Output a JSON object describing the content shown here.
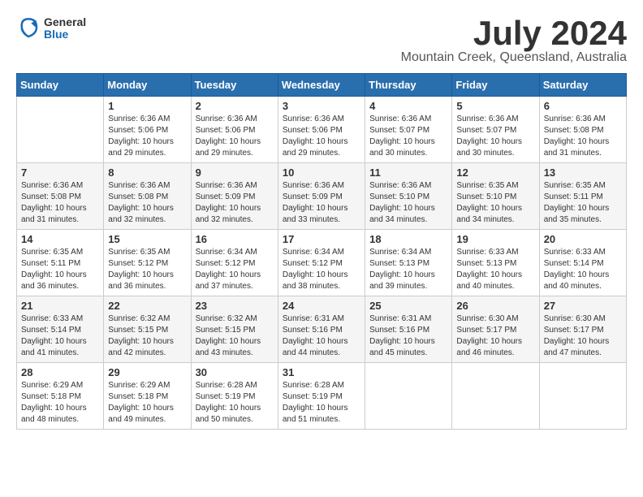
{
  "header": {
    "logo": {
      "general": "General",
      "blue": "Blue"
    },
    "title": "July 2024",
    "subtitle": "Mountain Creek, Queensland, Australia"
  },
  "calendar": {
    "weekdays": [
      "Sunday",
      "Monday",
      "Tuesday",
      "Wednesday",
      "Thursday",
      "Friday",
      "Saturday"
    ],
    "weeks": [
      [
        {
          "day": "",
          "info": ""
        },
        {
          "day": "1",
          "info": "Sunrise: 6:36 AM\nSunset: 5:06 PM\nDaylight: 10 hours\nand 29 minutes."
        },
        {
          "day": "2",
          "info": "Sunrise: 6:36 AM\nSunset: 5:06 PM\nDaylight: 10 hours\nand 29 minutes."
        },
        {
          "day": "3",
          "info": "Sunrise: 6:36 AM\nSunset: 5:06 PM\nDaylight: 10 hours\nand 29 minutes."
        },
        {
          "day": "4",
          "info": "Sunrise: 6:36 AM\nSunset: 5:07 PM\nDaylight: 10 hours\nand 30 minutes."
        },
        {
          "day": "5",
          "info": "Sunrise: 6:36 AM\nSunset: 5:07 PM\nDaylight: 10 hours\nand 30 minutes."
        },
        {
          "day": "6",
          "info": "Sunrise: 6:36 AM\nSunset: 5:08 PM\nDaylight: 10 hours\nand 31 minutes."
        }
      ],
      [
        {
          "day": "7",
          "info": "Sunrise: 6:36 AM\nSunset: 5:08 PM\nDaylight: 10 hours\nand 31 minutes."
        },
        {
          "day": "8",
          "info": "Sunrise: 6:36 AM\nSunset: 5:08 PM\nDaylight: 10 hours\nand 32 minutes."
        },
        {
          "day": "9",
          "info": "Sunrise: 6:36 AM\nSunset: 5:09 PM\nDaylight: 10 hours\nand 32 minutes."
        },
        {
          "day": "10",
          "info": "Sunrise: 6:36 AM\nSunset: 5:09 PM\nDaylight: 10 hours\nand 33 minutes."
        },
        {
          "day": "11",
          "info": "Sunrise: 6:36 AM\nSunset: 5:10 PM\nDaylight: 10 hours\nand 34 minutes."
        },
        {
          "day": "12",
          "info": "Sunrise: 6:35 AM\nSunset: 5:10 PM\nDaylight: 10 hours\nand 34 minutes."
        },
        {
          "day": "13",
          "info": "Sunrise: 6:35 AM\nSunset: 5:11 PM\nDaylight: 10 hours\nand 35 minutes."
        }
      ],
      [
        {
          "day": "14",
          "info": "Sunrise: 6:35 AM\nSunset: 5:11 PM\nDaylight: 10 hours\nand 36 minutes."
        },
        {
          "day": "15",
          "info": "Sunrise: 6:35 AM\nSunset: 5:12 PM\nDaylight: 10 hours\nand 36 minutes."
        },
        {
          "day": "16",
          "info": "Sunrise: 6:34 AM\nSunset: 5:12 PM\nDaylight: 10 hours\nand 37 minutes."
        },
        {
          "day": "17",
          "info": "Sunrise: 6:34 AM\nSunset: 5:12 PM\nDaylight: 10 hours\nand 38 minutes."
        },
        {
          "day": "18",
          "info": "Sunrise: 6:34 AM\nSunset: 5:13 PM\nDaylight: 10 hours\nand 39 minutes."
        },
        {
          "day": "19",
          "info": "Sunrise: 6:33 AM\nSunset: 5:13 PM\nDaylight: 10 hours\nand 40 minutes."
        },
        {
          "day": "20",
          "info": "Sunrise: 6:33 AM\nSunset: 5:14 PM\nDaylight: 10 hours\nand 40 minutes."
        }
      ],
      [
        {
          "day": "21",
          "info": "Sunrise: 6:33 AM\nSunset: 5:14 PM\nDaylight: 10 hours\nand 41 minutes."
        },
        {
          "day": "22",
          "info": "Sunrise: 6:32 AM\nSunset: 5:15 PM\nDaylight: 10 hours\nand 42 minutes."
        },
        {
          "day": "23",
          "info": "Sunrise: 6:32 AM\nSunset: 5:15 PM\nDaylight: 10 hours\nand 43 minutes."
        },
        {
          "day": "24",
          "info": "Sunrise: 6:31 AM\nSunset: 5:16 PM\nDaylight: 10 hours\nand 44 minutes."
        },
        {
          "day": "25",
          "info": "Sunrise: 6:31 AM\nSunset: 5:16 PM\nDaylight: 10 hours\nand 45 minutes."
        },
        {
          "day": "26",
          "info": "Sunrise: 6:30 AM\nSunset: 5:17 PM\nDaylight: 10 hours\nand 46 minutes."
        },
        {
          "day": "27",
          "info": "Sunrise: 6:30 AM\nSunset: 5:17 PM\nDaylight: 10 hours\nand 47 minutes."
        }
      ],
      [
        {
          "day": "28",
          "info": "Sunrise: 6:29 AM\nSunset: 5:18 PM\nDaylight: 10 hours\nand 48 minutes."
        },
        {
          "day": "29",
          "info": "Sunrise: 6:29 AM\nSunset: 5:18 PM\nDaylight: 10 hours\nand 49 minutes."
        },
        {
          "day": "30",
          "info": "Sunrise: 6:28 AM\nSunset: 5:19 PM\nDaylight: 10 hours\nand 50 minutes."
        },
        {
          "day": "31",
          "info": "Sunrise: 6:28 AM\nSunset: 5:19 PM\nDaylight: 10 hours\nand 51 minutes."
        },
        {
          "day": "",
          "info": ""
        },
        {
          "day": "",
          "info": ""
        },
        {
          "day": "",
          "info": ""
        }
      ]
    ]
  }
}
